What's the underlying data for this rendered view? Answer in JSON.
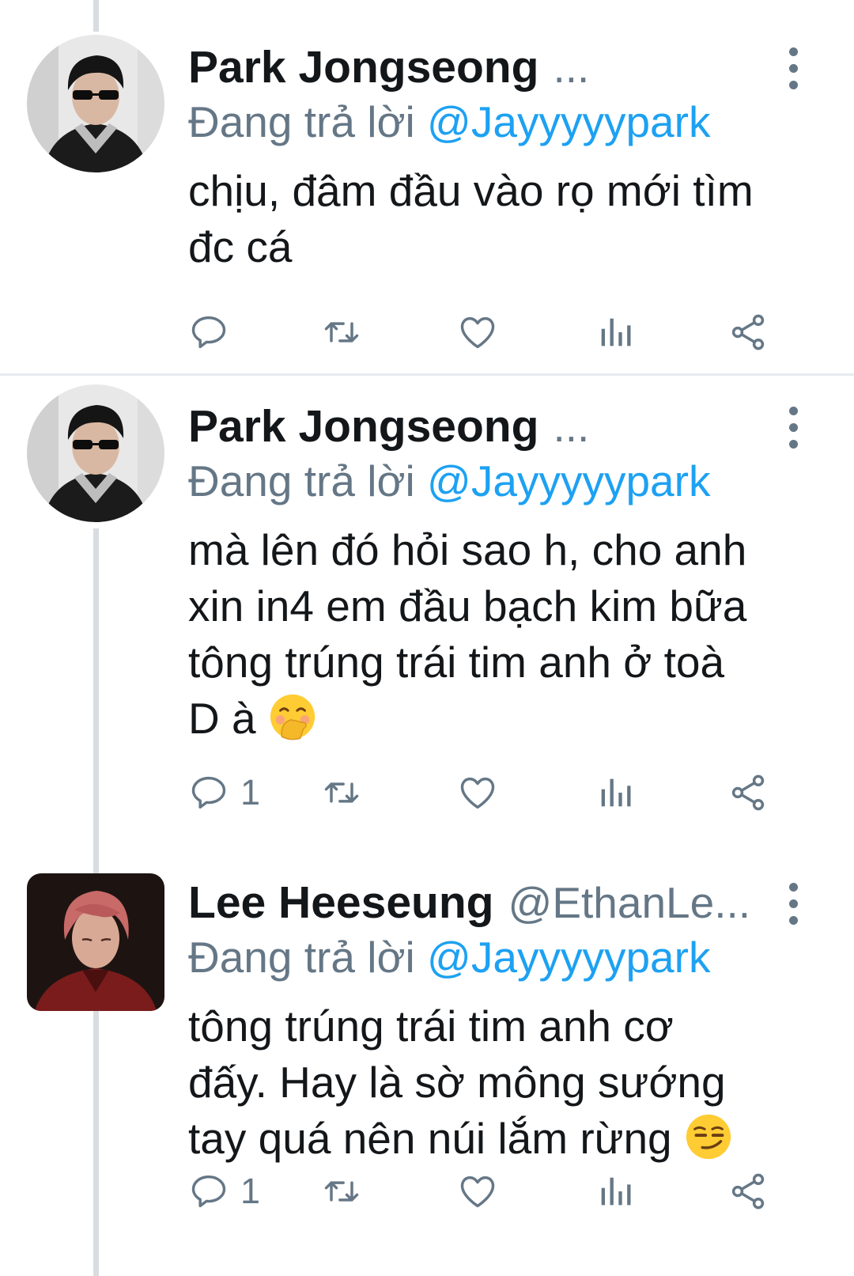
{
  "tweets": [
    {
      "name": "Park Jongseong",
      "name_suffix": "...",
      "handle": "",
      "replying_prefix": "Đang trả lời",
      "mention": "@Jayyyyypark",
      "lines": [
        "chịu, đâm đầu vào rọ mới tìm",
        "đc cá"
      ],
      "emoji": "",
      "reply_count": ""
    },
    {
      "name": "Park Jongseong",
      "name_suffix": "...",
      "handle": "",
      "replying_prefix": "Đang trả lời",
      "mention": "@Jayyyyypark",
      "lines": [
        "mà lên đó hỏi sao h, cho anh",
        "xin in4 em đầu bạch kim bữa",
        "tông trúng trái tim anh ở toà",
        "D à"
      ],
      "emoji": "face-with-hand-over-mouth",
      "reply_count": "1"
    },
    {
      "name": "Lee Heeseung",
      "name_suffix": "",
      "handle": "@EthanLe...",
      "replying_prefix": "Đang trả lời",
      "mention": "@Jayyyyypark",
      "lines": [
        "tông trúng trái tim anh cơ",
        "đấy. Hay là sờ mông sướng",
        "tay quá nên núi lắm rừng"
      ],
      "emoji": "smirking-face",
      "reply_count": "1"
    }
  ],
  "icons": {
    "reply": "reply-icon",
    "retweet": "retweet-icon",
    "like": "heart-icon",
    "analytics": "analytics-icon",
    "share": "share-icon",
    "more": "more-vertical-icon"
  },
  "colors": {
    "link": "#1da1f2",
    "secondary": "#657786",
    "text": "#14171a",
    "thread_line": "#d9dde1"
  }
}
